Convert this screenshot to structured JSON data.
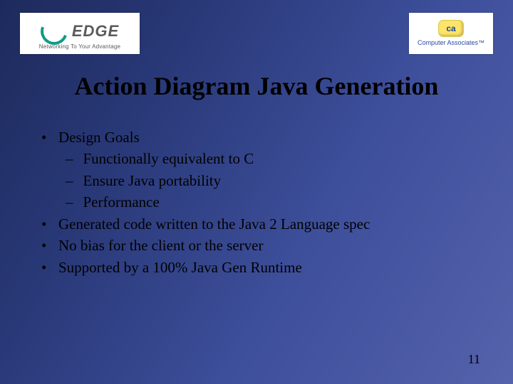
{
  "logos": {
    "left": {
      "word": "EDGE",
      "tagline": "Networking To Your Advantage"
    },
    "right": {
      "badge": "ca",
      "name": "Computer Associates™"
    }
  },
  "title": "Action Diagram Java Generation",
  "bullets": {
    "b0": "Design Goals",
    "s0": "Functionally equivalent to C",
    "s1": "Ensure Java portability",
    "s2": "Performance",
    "b1": "Generated code written to the Java 2 Language spec",
    "b2": "No bias for the client or the server",
    "b3": "Supported by a 100% Java Gen Runtime"
  },
  "page_number": "11"
}
